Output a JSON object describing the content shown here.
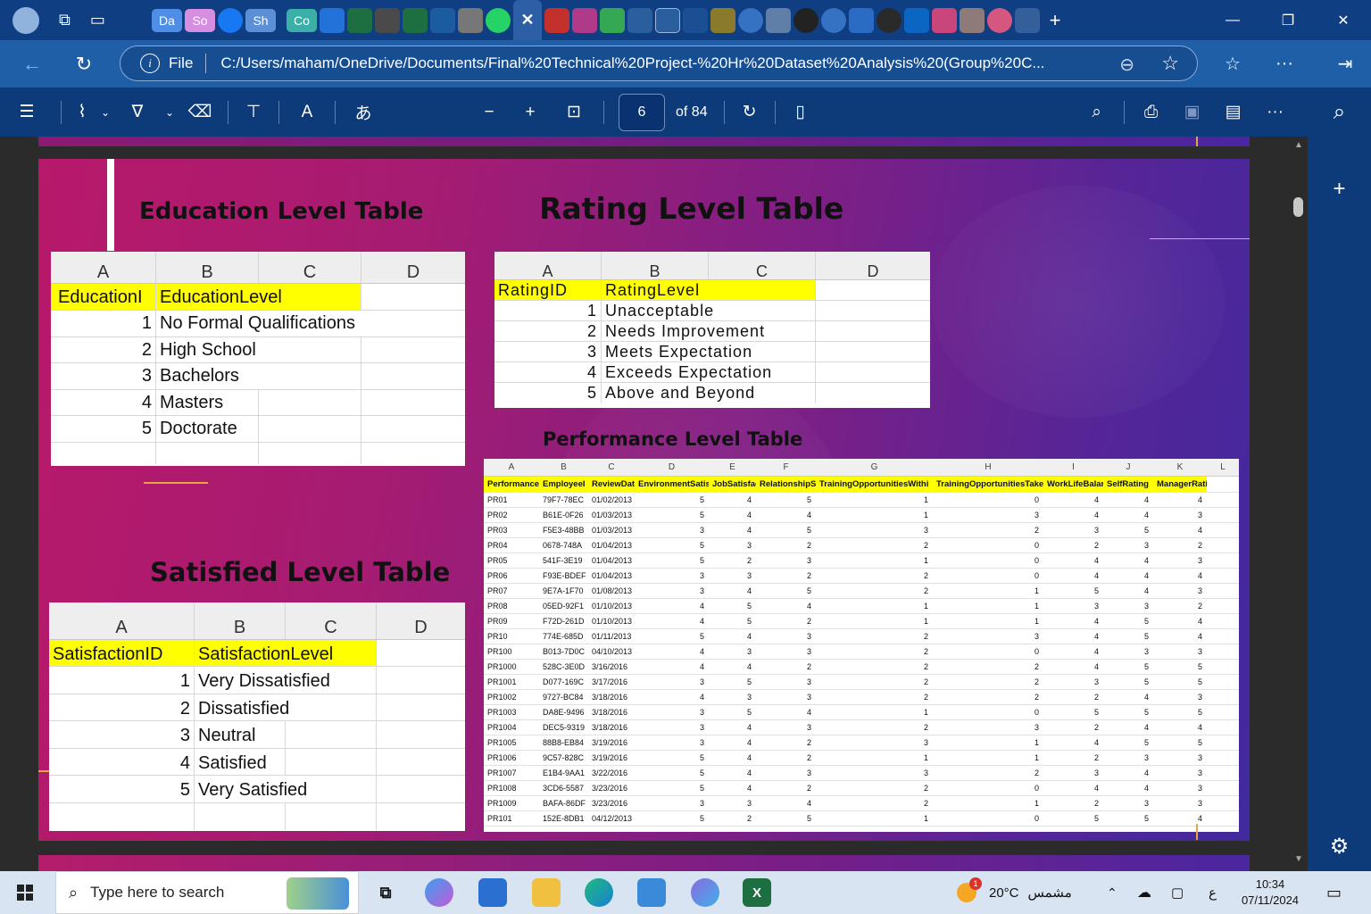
{
  "browser": {
    "tabs": [
      "Da",
      "So",
      "",
      "Sh",
      "",
      "Co",
      "",
      "",
      "",
      "",
      "",
      "",
      "",
      "",
      "",
      "",
      "",
      "",
      "",
      "",
      "",
      "",
      "",
      "",
      "",
      "",
      "",
      "",
      "",
      "",
      "",
      "",
      ""
    ],
    "url_label": "File",
    "url": "C:/Users/maham/OneDrive/Documents/Final%20Technical%20Project-%20Hr%20Dataset%20Analysis%20(Group%20C..."
  },
  "pdf_toolbar": {
    "page_number": "6",
    "page_total": "of 84"
  },
  "slide": {
    "education_title": "Education Level Table",
    "rating_title": "Rating Level Table",
    "satisfied_title": "Satisfied Level Table",
    "performance_title": "Performance Level Table"
  },
  "education_table": {
    "columns": [
      "A",
      "B",
      "C",
      "D"
    ],
    "header": [
      "EducationI",
      "EducationLevel"
    ],
    "rows": [
      {
        "id": "1",
        "level": "No Formal Qualifications"
      },
      {
        "id": "2",
        "level": "High School"
      },
      {
        "id": "3",
        "level": "Bachelors"
      },
      {
        "id": "4",
        "level": "Masters"
      },
      {
        "id": "5",
        "level": "Doctorate"
      }
    ]
  },
  "rating_table": {
    "columns": [
      "A",
      "B",
      "C",
      "D"
    ],
    "header": [
      "RatingID",
      "RatingLevel"
    ],
    "rows": [
      {
        "id": "1",
        "level": "Unacceptable"
      },
      {
        "id": "2",
        "level": "Needs Improvement"
      },
      {
        "id": "3",
        "level": "Meets Expectation"
      },
      {
        "id": "4",
        "level": "Exceeds Expectation"
      },
      {
        "id": "5",
        "level": "Above and Beyond"
      }
    ]
  },
  "satisfaction_table": {
    "columns": [
      "A",
      "B",
      "C",
      "D"
    ],
    "header": [
      "SatisfactionID",
      "SatisfactionLevel"
    ],
    "rows": [
      {
        "id": "1",
        "level": "Very Dissatisfied"
      },
      {
        "id": "2",
        "level": "Dissatisfied"
      },
      {
        "id": "3",
        "level": "Neutral"
      },
      {
        "id": "4",
        "level": "Satisfied"
      },
      {
        "id": "5",
        "level": "Very Satisfied"
      }
    ]
  },
  "performance_table": {
    "columns": [
      "A",
      "B",
      "C",
      "D",
      "E",
      "F",
      "G",
      "H",
      "I",
      "J",
      "K",
      "L"
    ],
    "header": [
      "Performance",
      "EmployeeI",
      "ReviewDat",
      "EnvironmentSatis",
      "JobSatisfac",
      "RelationshipSa",
      "TrainingOpportunitiesWithi",
      "TrainingOpportunitiesTake",
      "WorkLifeBalar",
      "SelfRating",
      "ManagerRating"
    ],
    "rows": [
      [
        "PR01",
        "79F7-78EC",
        "01/02/2013",
        "5",
        "4",
        "5",
        "1",
        "0",
        "4",
        "4",
        "4"
      ],
      [
        "PR02",
        "B61E-0F26",
        "01/03/2013",
        "5",
        "4",
        "4",
        "1",
        "3",
        "4",
        "4",
        "3"
      ],
      [
        "PR03",
        "F5E3-48BB",
        "01/03/2013",
        "3",
        "4",
        "5",
        "3",
        "2",
        "3",
        "5",
        "4"
      ],
      [
        "PR04",
        "0678-748A",
        "01/04/2013",
        "5",
        "3",
        "2",
        "2",
        "0",
        "2",
        "3",
        "2"
      ],
      [
        "PR05",
        "541F-3E19",
        "01/04/2013",
        "5",
        "2",
        "3",
        "1",
        "0",
        "4",
        "4",
        "3"
      ],
      [
        "PR06",
        "F93E-BDEF",
        "01/04/2013",
        "3",
        "3",
        "2",
        "2",
        "0",
        "4",
        "4",
        "4"
      ],
      [
        "PR07",
        "9E7A-1F70",
        "01/08/2013",
        "3",
        "4",
        "5",
        "2",
        "1",
        "5",
        "4",
        "3"
      ],
      [
        "PR08",
        "05ED-92F1",
        "01/10/2013",
        "4",
        "5",
        "4",
        "1",
        "1",
        "3",
        "3",
        "2"
      ],
      [
        "PR09",
        "F72D-261D",
        "01/10/2013",
        "4",
        "5",
        "2",
        "1",
        "1",
        "4",
        "5",
        "4"
      ],
      [
        "PR10",
        "774E-685D",
        "01/11/2013",
        "5",
        "4",
        "3",
        "2",
        "3",
        "4",
        "5",
        "4"
      ],
      [
        "PR100",
        "B013-7D0C",
        "04/10/2013",
        "4",
        "3",
        "3",
        "2",
        "0",
        "4",
        "3",
        "3"
      ],
      [
        "PR1000",
        "528C-3E0D",
        "3/16/2016",
        "4",
        "4",
        "2",
        "2",
        "2",
        "4",
        "5",
        "5"
      ],
      [
        "PR1001",
        "D077-169C",
        "3/17/2016",
        "3",
        "5",
        "3",
        "2",
        "2",
        "3",
        "5",
        "5"
      ],
      [
        "PR1002",
        "9727-BC84",
        "3/18/2016",
        "4",
        "3",
        "3",
        "2",
        "2",
        "2",
        "4",
        "3"
      ],
      [
        "PR1003",
        "DA8E-9496",
        "3/18/2016",
        "3",
        "5",
        "4",
        "1",
        "0",
        "5",
        "5",
        "5"
      ],
      [
        "PR1004",
        "DEC5-9319",
        "3/18/2016",
        "3",
        "4",
        "3",
        "2",
        "3",
        "2",
        "4",
        "4"
      ],
      [
        "PR1005",
        "88B8-EB84",
        "3/19/2016",
        "3",
        "4",
        "2",
        "3",
        "1",
        "4",
        "5",
        "5"
      ],
      [
        "PR1006",
        "9C57-828C",
        "3/19/2016",
        "5",
        "4",
        "2",
        "1",
        "1",
        "2",
        "3",
        "3"
      ],
      [
        "PR1007",
        "E1B4-9AA1",
        "3/22/2016",
        "5",
        "4",
        "3",
        "3",
        "2",
        "3",
        "4",
        "3"
      ],
      [
        "PR1008",
        "3CD6-5587",
        "3/23/2016",
        "5",
        "4",
        "2",
        "2",
        "0",
        "4",
        "4",
        "3"
      ],
      [
        "PR1009",
        "BAFA-86DF",
        "3/23/2016",
        "3",
        "3",
        "4",
        "2",
        "1",
        "2",
        "3",
        "3"
      ],
      [
        "PR101",
        "152E-8DB1",
        "04/12/2013",
        "5",
        "2",
        "5",
        "1",
        "0",
        "5",
        "5",
        "4"
      ]
    ]
  },
  "taskbar": {
    "search_placeholder": "Type here to search",
    "weather_temp": "20°C",
    "weather_text": "مشمس",
    "weather_badge": "1",
    "lang": "ع",
    "time": "10:34",
    "date": "07/11/2024"
  },
  "colors": {
    "accent_blue": "#1e5fa8",
    "toolbar_blue": "#0d3a78",
    "highlight_yellow": "#ffff00",
    "slide_pink": "#b8196a",
    "slide_purple": "#41299e"
  }
}
